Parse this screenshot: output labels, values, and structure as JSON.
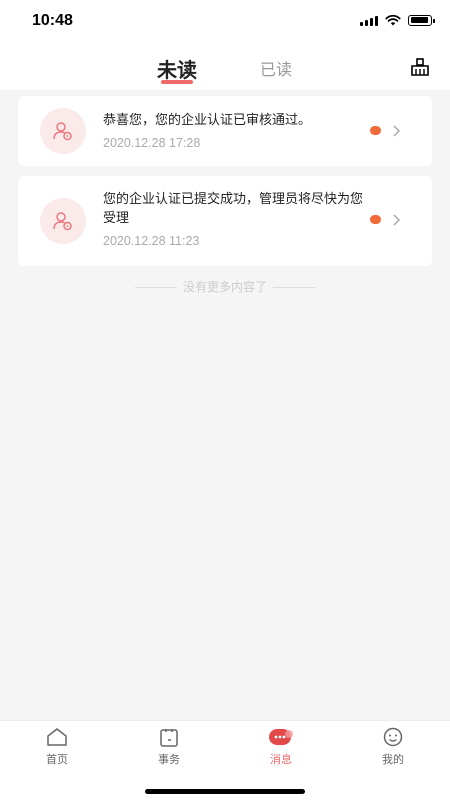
{
  "status": {
    "time": "10:48"
  },
  "header": {
    "tabs": [
      {
        "label": "未读",
        "active": true
      },
      {
        "label": "已读",
        "active": false
      }
    ],
    "right_icon": "broom-icon"
  },
  "messages": [
    {
      "text": "恭喜您，您的企业认证已审核通过。",
      "time": "2020.12.28 17:28",
      "unread": true
    },
    {
      "text": "您的企业认证已提交成功，管理员将尽快为您受理",
      "time": "2020.12.28 11:23",
      "unread": true
    }
  ],
  "no_more_text": "没有更多内容了",
  "tabbar": {
    "items": [
      {
        "label": "首页",
        "icon": "home-icon"
      },
      {
        "label": "事务",
        "icon": "task-icon"
      },
      {
        "label": "消息",
        "icon": "message-icon",
        "active": true
      },
      {
        "label": "我的",
        "icon": "profile-icon"
      }
    ]
  },
  "colors": {
    "accent": "#f06a6a",
    "unread_dot": "#f06a3a",
    "avatar_bg": "#fbeaea"
  }
}
